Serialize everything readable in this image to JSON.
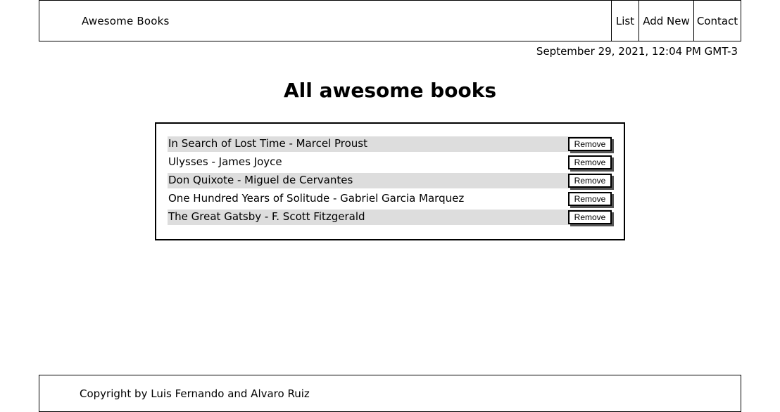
{
  "header": {
    "brand": "Awesome Books",
    "nav": {
      "list": "List",
      "add_new": "Add New",
      "contact": "Contact"
    }
  },
  "datetime": "September 29, 2021, 12:04 PM GMT-3",
  "main": {
    "title": "All awesome books",
    "remove_label": "Remove",
    "books": [
      {
        "text": "In Search of Lost Time - Marcel Proust"
      },
      {
        "text": "Ulysses - James Joyce"
      },
      {
        "text": "Don Quixote - Miguel de Cervantes"
      },
      {
        "text": "One Hundred Years of Solitude - Gabriel Garcia Marquez"
      },
      {
        "text": "The Great Gatsby - F. Scott Fitzgerald"
      }
    ]
  },
  "footer": {
    "text": "Copyright by Luis Fernando and Alvaro Ruiz"
  },
  "colors": {
    "stripe": "#dddddd",
    "border": "#000000",
    "shadow": "#555555"
  }
}
